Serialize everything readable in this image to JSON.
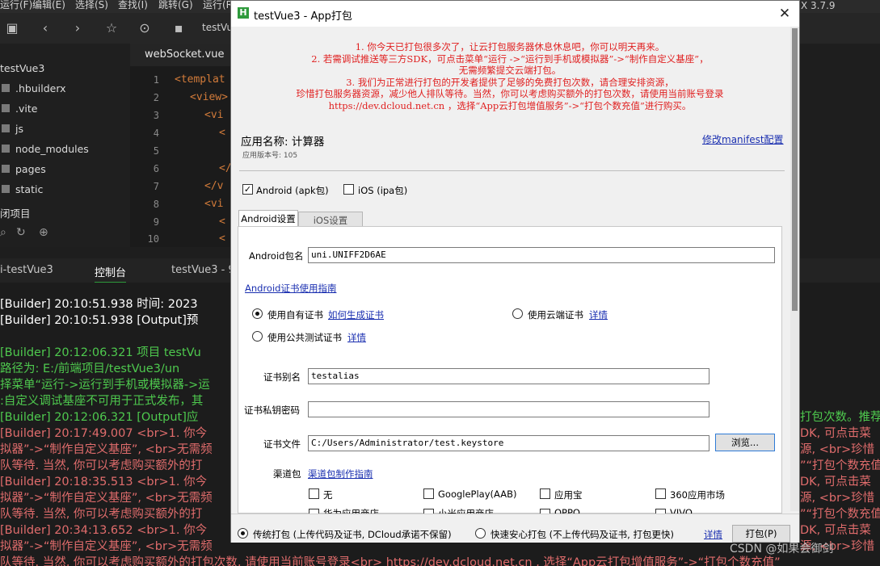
{
  "menubar": {
    "items": [
      "运行(F)",
      "编辑(E)",
      "选择(S)",
      "查找(I)",
      "跳转(G)",
      "运行(R"
    ],
    "version": "X 3.7.9"
  },
  "toolbar": {
    "project_tab": "testVu"
  },
  "sidebar": {
    "project": "testVue3",
    "items": [
      ".hbuilderx",
      ".vite",
      "js",
      "node_modules",
      "pages",
      "static"
    ],
    "closed_projects": "闭项目"
  },
  "editor": {
    "tab": "webSocket.vue",
    "line_numbers": [
      "1",
      "2",
      "3",
      "4",
      "5",
      "6",
      "7",
      "8",
      "9",
      "10"
    ],
    "lines": [
      "<templat",
      "<view>",
      "<vi",
      "<",
      "",
      "</",
      "</v",
      "<vi",
      "<",
      "<"
    ]
  },
  "console_tabs": {
    "left": "i-testVue3",
    "active": "控制台",
    "right": "testVue3 - 9"
  },
  "console": {
    "lines": [
      {
        "text": "[Builder] 20:10:51.938 时间: 2023",
        "color": "#ffffff"
      },
      {
        "text": "[Builder] 20:10:51.938 [Output]预",
        "color": "#ffffff"
      },
      {
        "text": "",
        "color": "#ffffff"
      },
      {
        "text": "[Builder] 20:12:06.321 项目 testVu",
        "color": "#4ec94e"
      },
      {
        "text": "   路径为: E:/前端项目/testVue3/un",
        "color": "#4ec94e"
      },
      {
        "text": "择菜单“运行->运行到手机或模拟器->运",
        "color": "#4ec94e"
      },
      {
        "text": ":自定义调试基座不可用于正式发布，其",
        "color": "#4ec94e"
      },
      {
        "text": "[Builder] 20:12:06.321 [Output]应",
        "color": "#4ec94e"
      },
      {
        "text": "[Builder] 20:17:49.007 <br>1. 你今",
        "color": "#e06c6c"
      },
      {
        "text": "拟器”->“制作自定义基座”, <br>无需频",
        "color": "#e06c6c"
      },
      {
        "text": "队等待. 当然, 你可以考虑购买额外的打",
        "color": "#e06c6c"
      },
      {
        "text": "[Builder] 20:18:35.513 <br>1. 你今",
        "color": "#e06c6c"
      },
      {
        "text": "拟器”->“制作自定义基座”, <br>无需频",
        "color": "#e06c6c"
      },
      {
        "text": "队等待. 当然, 你可以考虑购买额外的打",
        "color": "#e06c6c"
      },
      {
        "text": "[Builder] 20:34:13.652 <br>1. 你今",
        "color": "#e06c6c"
      },
      {
        "text": "拟器”->“制作自定义基座”, <br>无需频",
        "color": "#e06c6c"
      },
      {
        "text": "队等待. 当然, 你可以考虑购买额外的打包次数, 请使用当前账号登录<br> https://dev.dcloud.net.cn , 选择“App云打包增值服务”->“打包个数充值”",
        "color": "#e06c6c"
      }
    ],
    "right_fragments": [
      {
        "text": "打包次数。推荐",
        "color": "#4ec94e"
      },
      {
        "text": "DK, 可点击菜",
        "color": "#e06c6c"
      },
      {
        "text": "源, <br>珍惜",
        "color": "#e06c6c"
      },
      {
        "text": "”“打包个数充值",
        "color": "#e06c6c"
      },
      {
        "text": "DK, 可点击菜",
        "color": "#e06c6c"
      },
      {
        "text": "源, <br>珍惜",
        "color": "#e06c6c"
      },
      {
        "text": "”“打包个数充值",
        "color": "#e06c6c"
      },
      {
        "text": "DK, 可点击菜",
        "color": "#e06c6c"
      },
      {
        "text": "源, <br>珍惜",
        "color": "#e06c6c"
      }
    ]
  },
  "dialog": {
    "title": "testVue3 - App打包",
    "app_icon_letter": "H",
    "notice": [
      "1. 你今天已打包很多次了，让云打包服务器休息休息吧，你可以明天再来。",
      "2. 若需调试推送等三方SDK，可点击菜单“运行 ->“运行到手机或模拟器”->“制作自定义基座”，",
      "无需频繁提交云端打包。",
      "3. 我们为正常进行打包的开发者提供了足够的免费打包次数，请合理安排资源，",
      "珍惜打包服务器资源，减少他人排队等待。当然，你可以考虑购买额外的打包次数，请使用当前账号登录",
      "https://dev.dcloud.net.cn ，选择“App云打包增值服务”->“打包个数充值”进行购买。"
    ],
    "app_name": "应用名称: 计算器",
    "app_version": "应用版本号: 105",
    "edit_manifest": "修改manifest配置",
    "platforms": {
      "android_label": "Android (apk包)",
      "android_checked": true,
      "ios_label": "iOS (ipa包)",
      "ios_checked": false
    },
    "tabs": {
      "android": "Android设置",
      "ios": "iOS设置"
    },
    "package_label": "Android包名",
    "package_value": "uni.UNIFF2D6AE",
    "cert_guide": "Android证书使用指南",
    "cert_options": {
      "own": "使用自有证书",
      "own_link": "如何生成证书",
      "cloud": "使用云端证书",
      "cloud_link": "详情",
      "public": "使用公共测试证书",
      "public_link": "详情",
      "selected": "own"
    },
    "alias_label": "证书别名",
    "alias_value": "testalias",
    "password_label": "证书私钥密码",
    "password_value": "",
    "file_label": "证书文件",
    "file_value": "C:/Users/Administrator/test.keystore",
    "browse_button": "浏览...",
    "channel_label": "渠道包",
    "channel_link": "渠道包制作指南",
    "channels": [
      "无",
      "GooglePlay(AAB)",
      "应用宝",
      "360应用市场"
    ],
    "channels_row2": [
      "华为应用商店",
      "小米应用商店",
      "OPPO",
      "VIVO"
    ],
    "pack_modes": {
      "traditional": "传统打包 (上传代码及证书, DCloud承诺不保留)",
      "safe": "快速安心打包 (不上传代码及证书, 打包更快)",
      "details": "详情",
      "selected": "traditional"
    },
    "pack_button": "打包(P)"
  },
  "watermark": "CSDN @如果会御剑"
}
